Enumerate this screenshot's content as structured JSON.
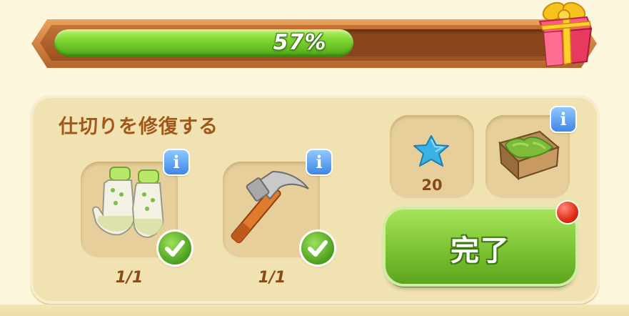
{
  "progress": {
    "label": "57%",
    "fraction": 0.57
  },
  "task": {
    "title": "仕切りを修復する",
    "requirements": [
      {
        "name": "gloves",
        "icon": "gardening-gloves-icon",
        "count": "1/1",
        "complete": true
      },
      {
        "name": "hammer",
        "icon": "hammer-icon",
        "count": "1/1",
        "complete": true
      }
    ],
    "rewards": [
      {
        "icon": "blue-star-icon",
        "count": "20"
      },
      {
        "icon": "planter-box-icon"
      }
    ],
    "complete_label": "完了"
  },
  "colors": {
    "background": "#fbf6dc",
    "progress_fill": "#7fd630",
    "title_text": "#a2571a",
    "complete_button": "#7cc332",
    "notification": "#e02a18",
    "info_button": "#3f86e6"
  }
}
